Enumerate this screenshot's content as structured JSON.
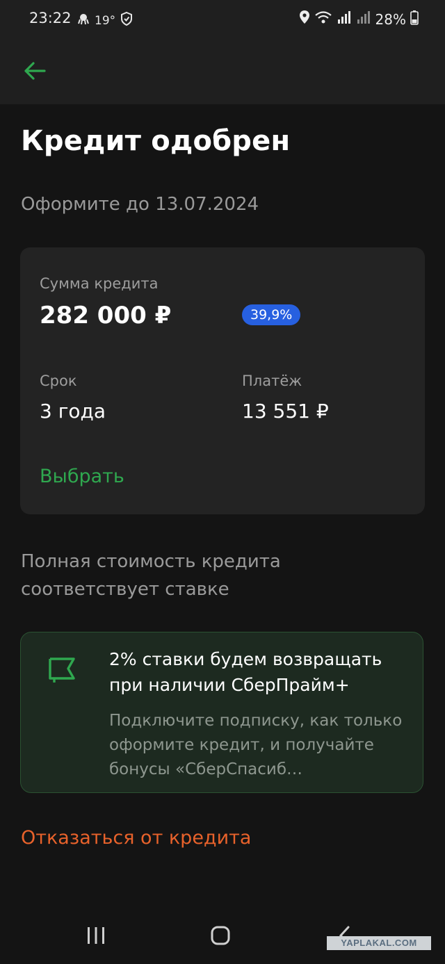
{
  "status_bar": {
    "time": "23:22",
    "temperature": "19°",
    "battery": "28%",
    "icons": [
      "octopus-icon",
      "shield-icon",
      "location-icon",
      "wifi-icon",
      "signal-icon",
      "battery-icon"
    ]
  },
  "header": {
    "back_icon": "arrow-left-icon"
  },
  "page": {
    "title": "Кредит одобрен",
    "subtitle": "Оформите до 13.07.2024"
  },
  "offer": {
    "amount_label": "Сумма кредита",
    "amount_value": "282 000 ₽",
    "rate": "39,9%",
    "term_label": "Срок",
    "term_value": "3 года",
    "payment_label": "Платёж",
    "payment_value": "13 551 ₽",
    "choose_label": "Выбрать"
  },
  "cost_note": "Полная стоимость кредита соответствует ставке",
  "promo": {
    "icon": "flag-icon",
    "title": "2% ставки будем возвращать при наличии СберПрайм+",
    "text": "Подключите подписку, как только оформите кредит, и получайте бонусы «СберСпасиб…"
  },
  "decline_label": "Отказаться от кредита",
  "watermark": "YAPLAKAL.COM",
  "colors": {
    "accent_green": "#2fa84f",
    "badge_blue": "#2760e0",
    "decline_orange": "#e8622b",
    "background": "#141414"
  }
}
